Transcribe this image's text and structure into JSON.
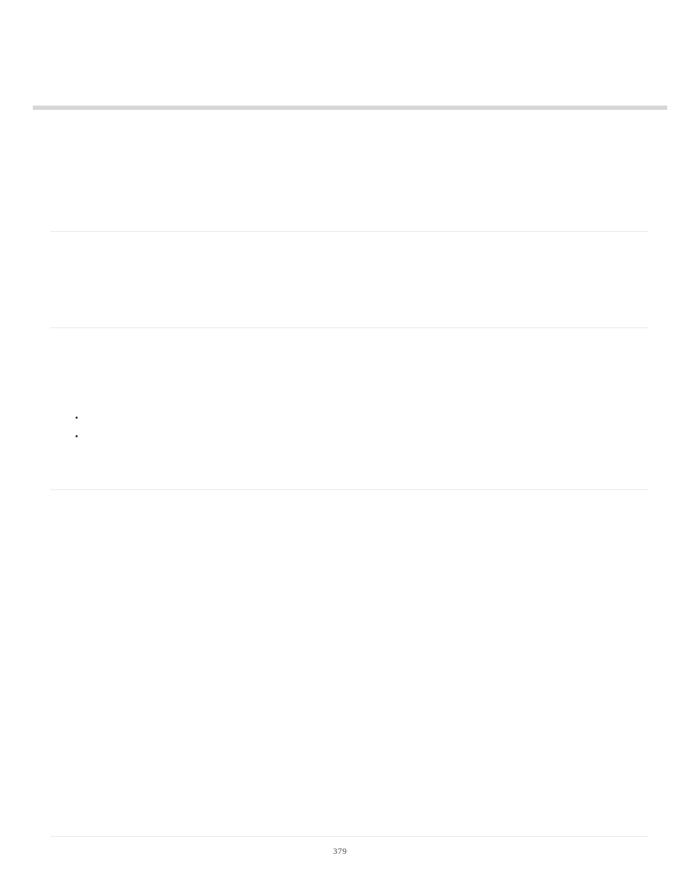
{
  "page_number": "379"
}
